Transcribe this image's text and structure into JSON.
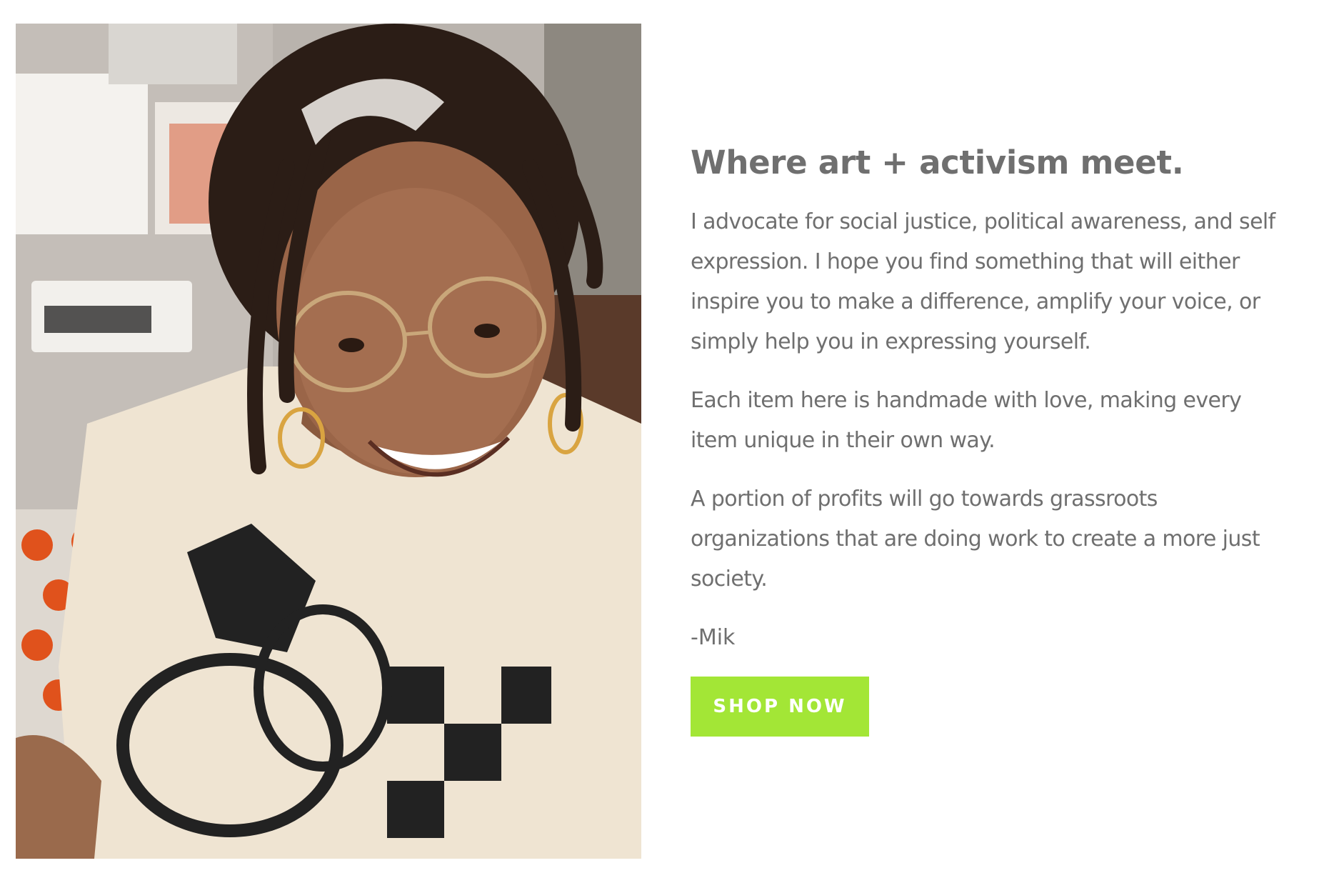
{
  "about": {
    "photo_alt": "Portrait of Mik smiling",
    "heading": "Where art + activism meet.",
    "paragraphs": [
      "I advocate for social justice, political awareness, and self expression. I hope you find something that will either inspire you to make a difference, amplify your voice, or simply help you in expressing yourself.",
      "Each item here is handmade with love, making every item unique in their own way.",
      "A portion of profits will go towards grassroots organizations that are doing work to create a more just society."
    ],
    "signature": "-Mik",
    "cta_label": "SHOP NOW"
  },
  "colors": {
    "text": "#6f6f6f",
    "button_bg": "#a3e636",
    "button_text": "#ffffff",
    "background": "#ffffff"
  }
}
